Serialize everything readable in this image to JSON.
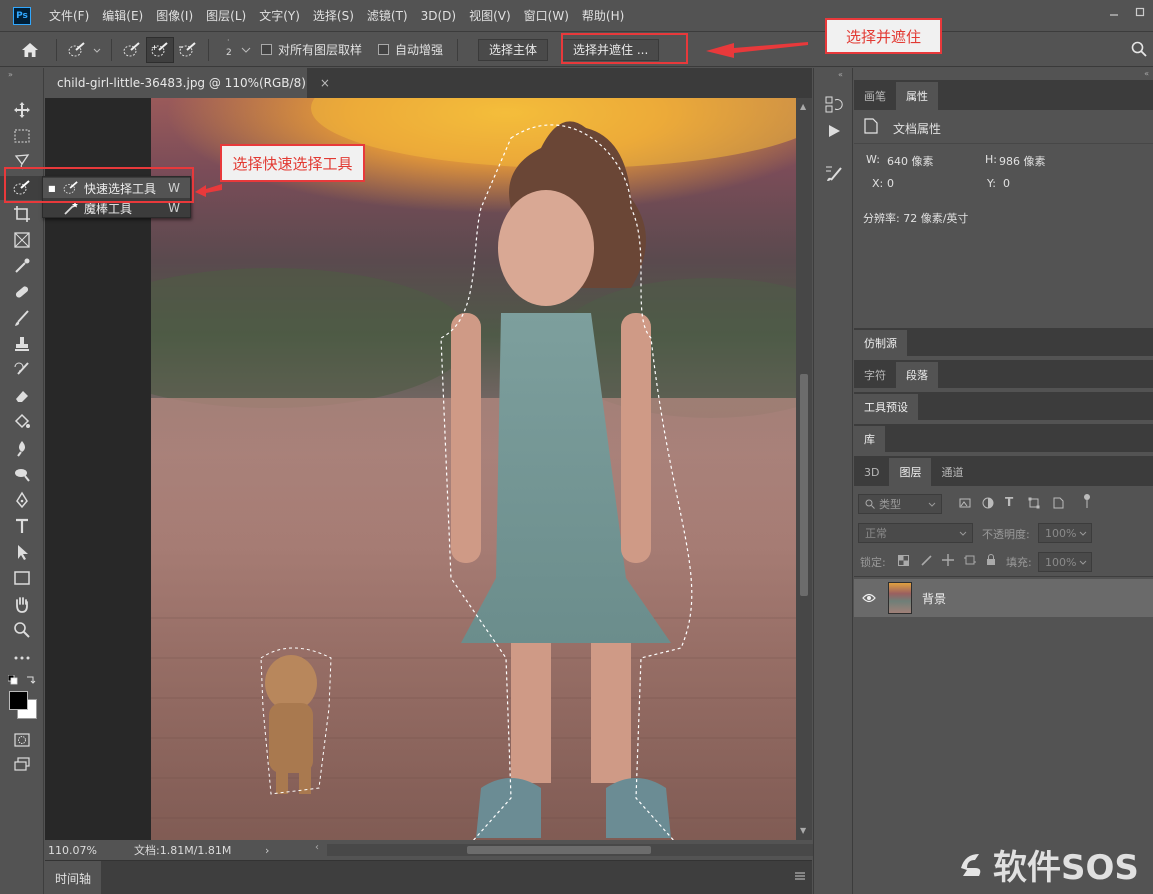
{
  "app": {
    "logo": "Ps"
  },
  "menu": [
    "文件(F)",
    "编辑(E)",
    "图像(I)",
    "图层(L)",
    "文字(Y)",
    "选择(S)",
    "滤镜(T)",
    "3D(D)",
    "视图(V)",
    "窗口(W)",
    "帮助(H)"
  ],
  "options": {
    "brush_size": "2",
    "sample_all_layers": "对所有图层取样",
    "auto_enhance": "自动增强",
    "select_subject": "选择主体",
    "select_and_mask": "选择并遮住 ..."
  },
  "document": {
    "tab_title": "child-girl-little-36483.jpg @ 110%(RGB/8)",
    "close_glyph": "×",
    "zoom": "110.07%",
    "doc_size": "文档:1.81M/1.81M"
  },
  "flyout": {
    "items": [
      {
        "label": "快速选择工具",
        "key": "W"
      },
      {
        "label": "魔棒工具",
        "key": "W"
      }
    ]
  },
  "annotations": {
    "tool_label": "选择快速选择工具",
    "mask_label": "选择并遮住",
    "color": "#e8393b"
  },
  "panels": {
    "top_tabs": [
      "画笔",
      "属性"
    ],
    "doc_props_title": "文档属性",
    "w_label": "W:",
    "w_value": "640 像素",
    "h_label": "H:",
    "h_value": "986 像素",
    "x_label": "X:",
    "x_value": "0",
    "y_label": "Y:",
    "y_value": "0",
    "resolution": "分辨率: 72 像素/英寸",
    "clone_source": "仿制源",
    "char_tabs": [
      "字符",
      "段落"
    ],
    "tool_presets": "工具预设",
    "library": "库",
    "layer_tabs": [
      "3D",
      "图层",
      "通道"
    ],
    "filter_kind": "类型",
    "blend_mode": "正常",
    "opacity_label": "不透明度:",
    "opacity_value": "100%",
    "lock_label": "锁定:",
    "fill_label": "填充:",
    "fill_value": "100%",
    "layer_name": "背景"
  },
  "timeline": {
    "label": "时间轴"
  },
  "watermark": {
    "text": "软件SOS"
  }
}
